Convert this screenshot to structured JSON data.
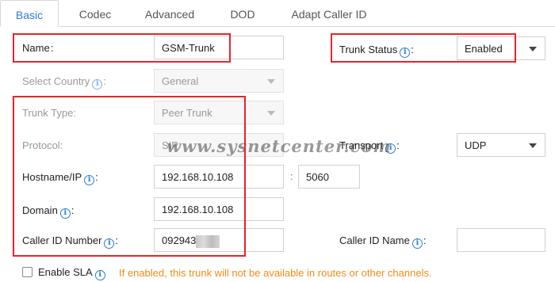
{
  "tabs": [
    {
      "label": "Basic",
      "active": true
    },
    {
      "label": "Codec",
      "active": false
    },
    {
      "label": "Advanced",
      "active": false
    },
    {
      "label": "DOD",
      "active": false
    },
    {
      "label": "Adapt Caller ID",
      "active": false
    }
  ],
  "name": {
    "label": "Name",
    "value": "GSM-Trunk"
  },
  "trunk_status": {
    "label": "Trunk Status",
    "value": "Enabled"
  },
  "select_country": {
    "label": "Select Country",
    "value": "General"
  },
  "trunk_type": {
    "label": "Trunk Type:",
    "value": "Peer Trunk"
  },
  "protocol": {
    "label": "Protocol:",
    "value": "SIP"
  },
  "transport": {
    "label": "Transport",
    "value": "UDP"
  },
  "hostname": {
    "label": "Hostname/IP",
    "value": "192.168.10.108",
    "port_separator": ":",
    "port": "5060"
  },
  "domain": {
    "label": "Domain",
    "value": "192.168.10.108"
  },
  "caller_id_number": {
    "label": "Caller ID Number",
    "value": "092943"
  },
  "caller_id_name": {
    "label": "Caller ID Name",
    "value": ""
  },
  "sla": {
    "label": "Enable SLA",
    "checked": false,
    "hint": "If enabled, this trunk will not be available in routes or other channels."
  },
  "watermark": "www.sysnetcenter.com",
  "colors": {
    "accent": "#2b7fd4",
    "highlight_box": "#e8242a",
    "hint": "#f08c1a"
  }
}
